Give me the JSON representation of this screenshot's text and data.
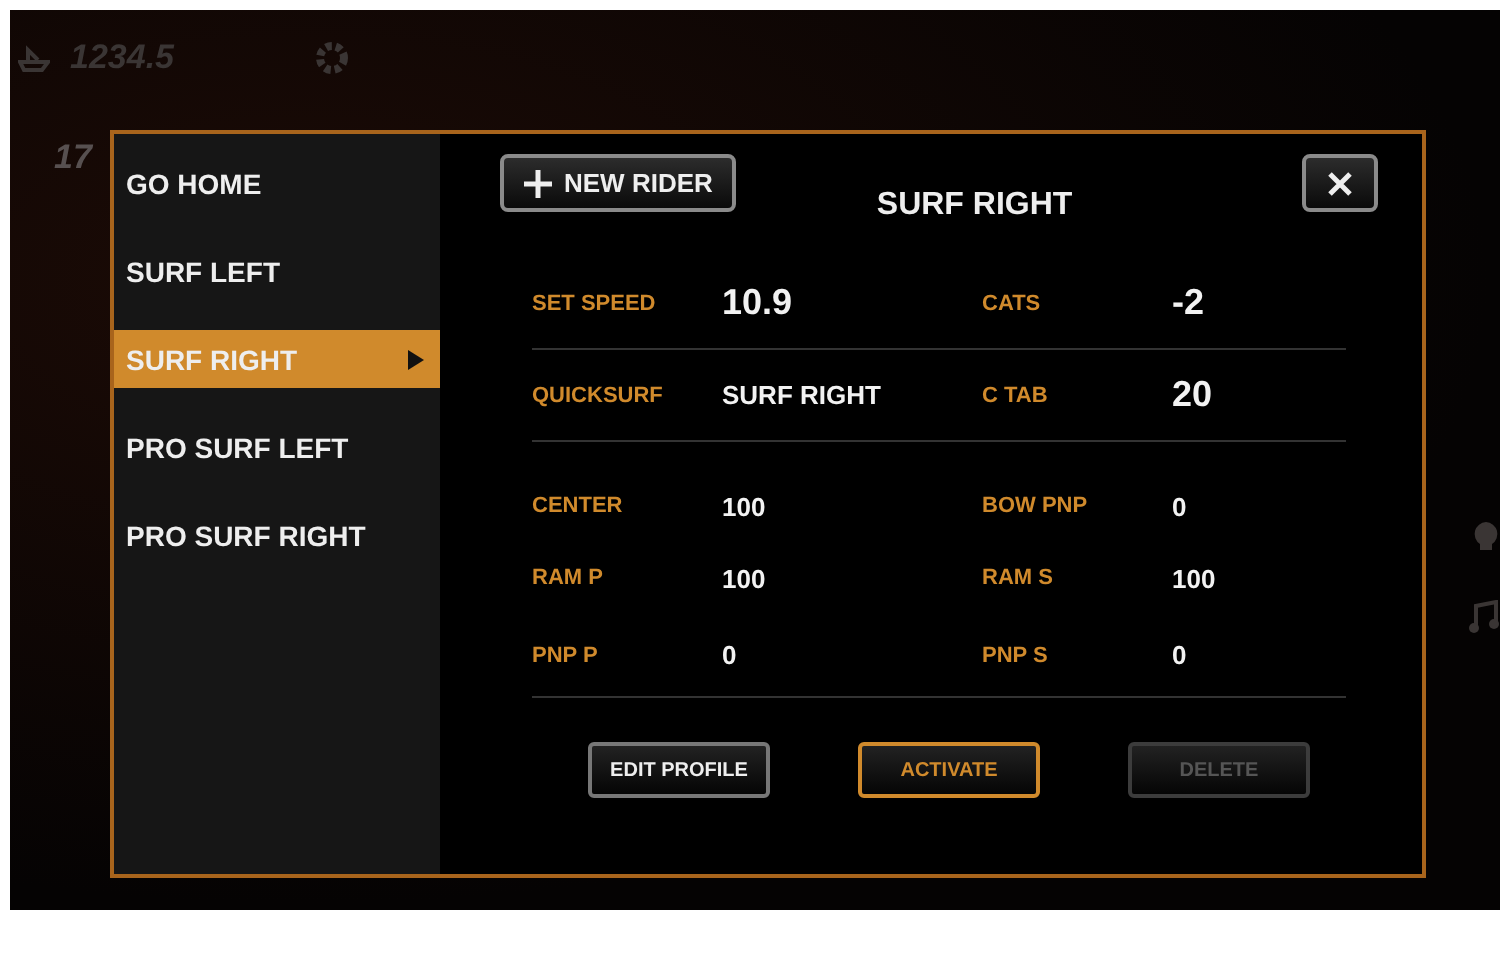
{
  "dashboard": {
    "odometer": "1234.5",
    "second_reading": "17"
  },
  "menu": [
    {
      "label": "GO HOME",
      "selected": false
    },
    {
      "label": "SURF LEFT",
      "selected": false
    },
    {
      "label": "SURF RIGHT",
      "selected": true
    },
    {
      "label": "PRO SURF LEFT",
      "selected": false
    },
    {
      "label": "PRO SURF RIGHT",
      "selected": false
    }
  ],
  "new_rider_button": "NEW RIDER",
  "title": "SURF RIGHT",
  "primary_fields": [
    {
      "label": "SET SPEED",
      "value": "10.9"
    },
    {
      "label": "CATS",
      "value": "-2"
    },
    {
      "label": "QUICKSURF",
      "value": "SURF RIGHT"
    },
    {
      "label": "C TAB",
      "value": "20"
    }
  ],
  "secondary_fields": [
    {
      "label": "CENTER",
      "value": "100"
    },
    {
      "label": "BOW PNP",
      "value": "0"
    },
    {
      "label": "RAM P",
      "value": "100"
    },
    {
      "label": "RAM S",
      "value": "100"
    },
    {
      "label": "PNP P",
      "value": "0"
    },
    {
      "label": "PNP S",
      "value": "0"
    }
  ],
  "actions": [
    {
      "label": "EDIT PROFILE",
      "kind": "normal"
    },
    {
      "label": "ACTIVATE",
      "kind": "accent"
    },
    {
      "label": "DELETE",
      "kind": "disabled"
    }
  ]
}
